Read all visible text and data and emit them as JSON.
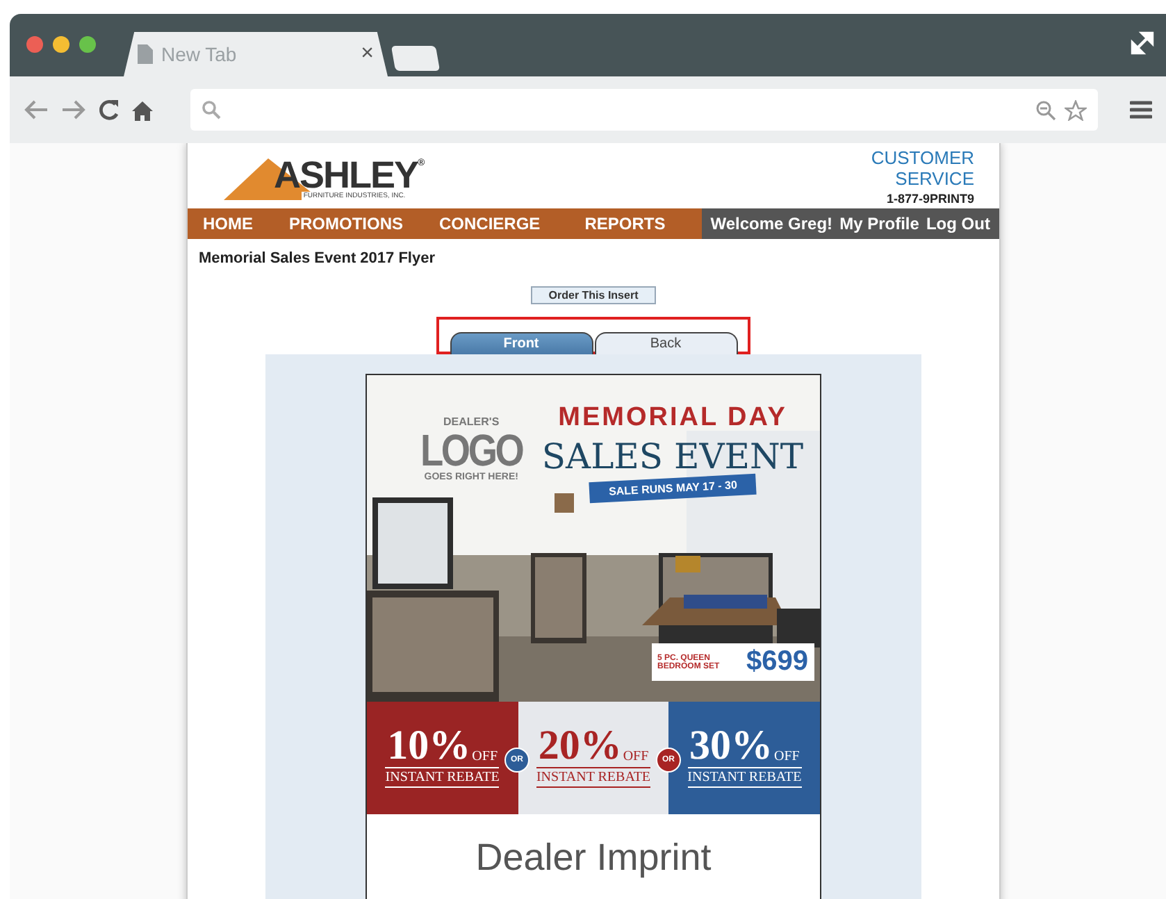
{
  "browser": {
    "tab": {
      "title": "New Tab",
      "close": "×"
    }
  },
  "site": {
    "logo": {
      "name": "ASHLEY$^{®}$",
      "tagline": "FURNITURE INDUSTRIES, INC."
    },
    "customer_service": {
      "title": "CUSTOMER SERVICE",
      "phone": "1-877-9PRINT9"
    },
    "nav": [
      {
        "label": "HOME"
      },
      {
        "label": "PROMOTIONS"
      },
      {
        "label": "CONCIERGE"
      },
      {
        "label": "REPORTS"
      }
    ],
    "user_nav": [
      {
        "label": "Welcome Greg!"
      },
      {
        "label": "My Profile"
      },
      {
        "label": "Log Out"
      }
    ]
  },
  "page_title": "Memorial Sales Event 2017 Flyer",
  "order_button": "Order This Insert",
  "view_tabs": [
    {
      "label": "Front",
      "selected": true
    },
    {
      "label": "Back",
      "selected": false
    }
  ],
  "flyer": {
    "logo_hint": {
      "top": "DEALER'S",
      "main": "LOGO",
      "bottom": "GOES RIGHT HERE!"
    },
    "headline": {
      "top": "MEMORIAL DAY",
      "main": "SALES EVENT",
      "banner": "SALE RUNS MAY 17 - 30"
    },
    "price_tag": {
      "item": "5 PC. QUEEN BEDROOM SET",
      "price": "$699"
    },
    "rebates": [
      {
        "value": "10%",
        "off": "OFF",
        "label": "INSTANT REBATE",
        "kind": "dark",
        "color": "#9a2424"
      },
      {
        "value": "20%",
        "off": "OFF",
        "label": "INSTANT REBATE",
        "kind": "light",
        "color": "#e6e8ec"
      },
      {
        "value": "30%",
        "off": "OFF",
        "label": "INSTANT REBATE",
        "kind": "dark",
        "color": "#2d5d98"
      }
    ],
    "separators": [
      "OR",
      "OR"
    ],
    "imprint": "Dealer Imprint"
  }
}
